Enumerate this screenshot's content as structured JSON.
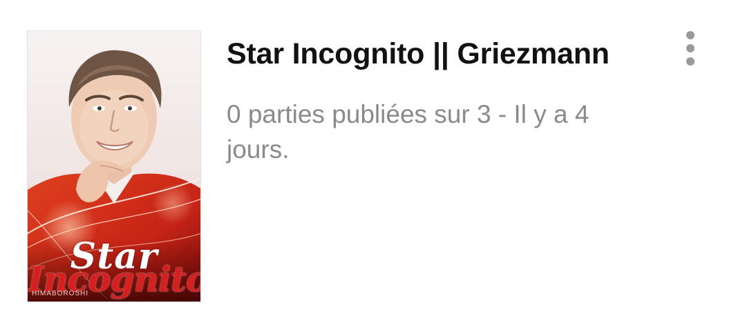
{
  "story": {
    "cover": {
      "alt": "Star Incognito",
      "title_line1": "Star",
      "title_line2": "Incognito",
      "credit": "HIMABOROSHI"
    },
    "title": "Star Incognito || Griezmann",
    "meta": "0 parties publiées sur 3 - Il y a 4 jours."
  },
  "menu": {
    "icon": "more-vert-icon"
  },
  "colors": {
    "title": "#121212",
    "meta": "#8a8a8a",
    "menu_dots": "#9a9a9a",
    "cover_red": "#d81f1f"
  }
}
